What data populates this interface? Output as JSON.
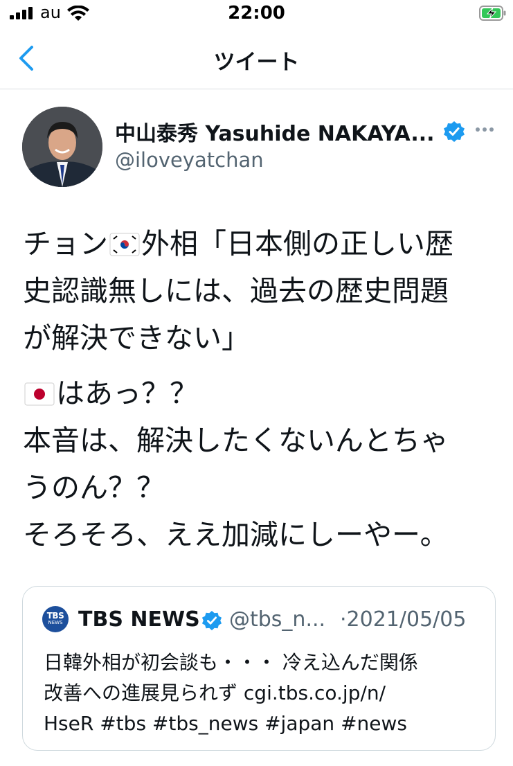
{
  "status_bar": {
    "carrier": "au",
    "time": "22:00"
  },
  "nav": {
    "title": "ツイート",
    "back_icon": "chevron-left-icon"
  },
  "author": {
    "display_name": "中山泰秀 Yasuhide NAKAYA...",
    "handle": "@iloveyatchan",
    "verified": true
  },
  "tweet": {
    "para1": {
      "part1": "チョン",
      "flag": "kr-flag-icon",
      "part2": "外相「日本側の正しい歴\n史認識無しには、過去の歴史問題\nが解決できない」"
    },
    "para2": {
      "flag": "jp-flag-icon",
      "part1": "はあっ？？\n本音は、解決したくないんとちゃ\nうのん？？\nそろそろ、ええ加減にしーやー。"
    }
  },
  "quote": {
    "logo_text": "TBS",
    "logo_sub": "NEWS",
    "name": "TBS NEWS",
    "handle": "@tbs_n...",
    "date": "·2021/05/05",
    "text": "日韓外相が初会談も・・・ 冷え込んだ関係\n改善への進展見られず cgi.tbs.co.jp/n/\nHseR #tbs #tbs_news #japan #news"
  },
  "colors": {
    "verified_blue": "#1d9bf0",
    "link_blue": "#1d9bf0",
    "secondary_text": "#536471",
    "tbs_blue": "#1d4f9c"
  }
}
